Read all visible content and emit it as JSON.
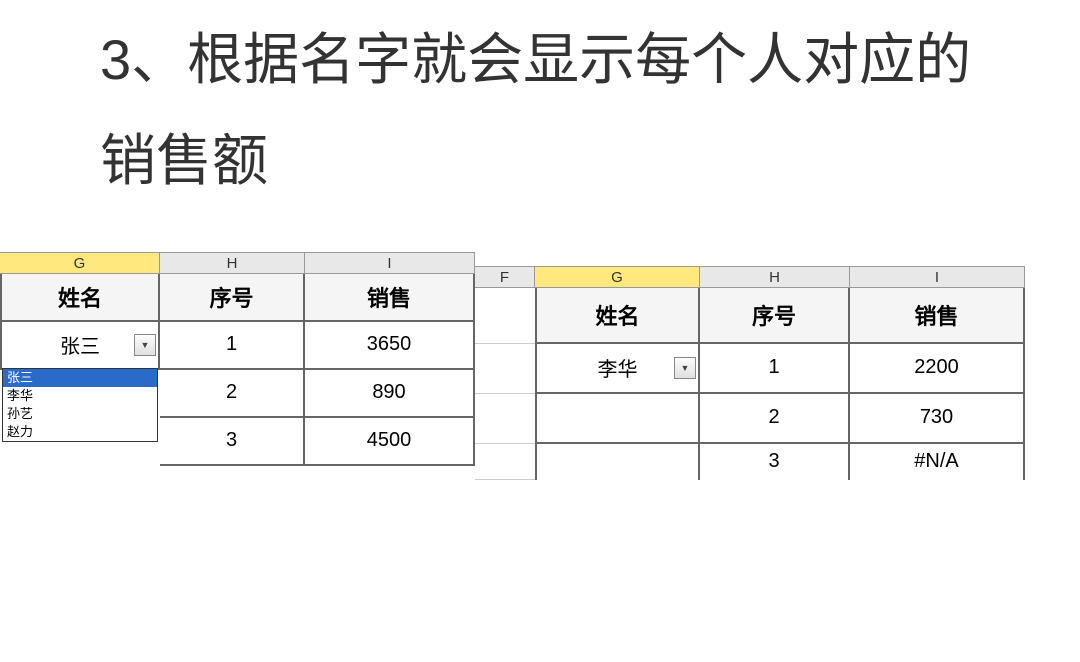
{
  "instruction": "3、根据名字就会显示每个人对应的销售额",
  "left_sheet": {
    "columns": {
      "g": "G",
      "h": "H",
      "i": "I"
    },
    "headers": {
      "name": "姓名",
      "seq": "序号",
      "sales": "销售"
    },
    "selected_name": "张三",
    "dropdown_options": [
      "张三",
      "李华",
      "孙艺",
      "赵力"
    ],
    "rows": [
      {
        "seq": "1",
        "sales": "3650"
      },
      {
        "seq": "2",
        "sales": "890"
      },
      {
        "seq": "3",
        "sales": "4500"
      }
    ]
  },
  "right_sheet": {
    "columns": {
      "f": "F",
      "g": "G",
      "h": "H",
      "i": "I"
    },
    "headers": {
      "name": "姓名",
      "seq": "序号",
      "sales": "销售"
    },
    "selected_name": "李华",
    "rows": [
      {
        "seq": "1",
        "sales": "2200"
      },
      {
        "seq": "2",
        "sales": "730"
      },
      {
        "seq": "3",
        "sales": "#N/A"
      }
    ]
  }
}
